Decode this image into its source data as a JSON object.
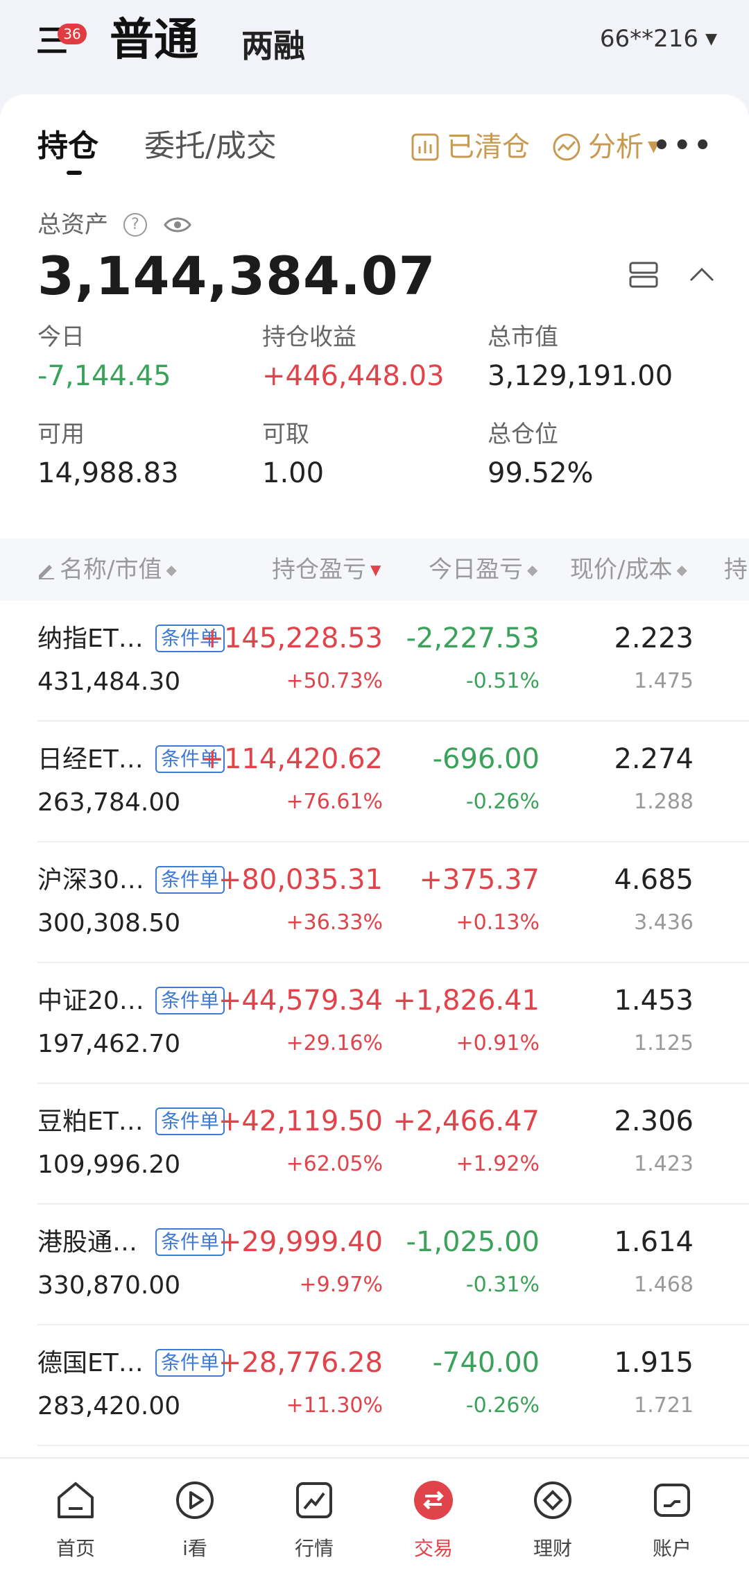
{
  "header": {
    "menu_badge": "36",
    "mode_primary": "普通",
    "mode_secondary": "两融",
    "account": "66**216"
  },
  "tabs": [
    {
      "label": "持仓",
      "active": true
    },
    {
      "label": "委托/成交",
      "active": false
    }
  ],
  "tools": {
    "cleared": "已清仓",
    "analysis": "分析"
  },
  "summary": {
    "total_label": "总资产",
    "total_value": "3,144,384.07",
    "stats": [
      {
        "label": "今日",
        "value": "-7,144.45",
        "tone": "green"
      },
      {
        "label": "持仓收益",
        "value": "+446,448.03",
        "tone": "red"
      },
      {
        "label": "总市值",
        "value": "3,129,191.00",
        "tone": "normal"
      },
      {
        "label": "可用",
        "value": "14,988.83",
        "tone": "normal"
      },
      {
        "label": "可取",
        "value": "1.00",
        "tone": "normal"
      },
      {
        "label": "总仓位",
        "value": "99.52%",
        "tone": "normal"
      }
    ]
  },
  "table": {
    "headers": {
      "name": "名称/市值",
      "holding_pl": "持仓盈亏",
      "today_pl": "今日盈亏",
      "price_cost": "现价/成本",
      "extra": "持"
    },
    "tag_label": "条件单",
    "rows": [
      {
        "name": "纳指ET…",
        "market_value": "431,484.30",
        "hold_pl": "+145,228.53",
        "hold_pct": "+50.73%",
        "today_pl": "-2,227.53",
        "today_pct": "-0.51%",
        "price": "2.223",
        "cost": "1.475",
        "hold_tone": "red",
        "today_tone": "green"
      },
      {
        "name": "日经ET…",
        "market_value": "263,784.00",
        "hold_pl": "+114,420.62",
        "hold_pct": "+76.61%",
        "today_pl": "-696.00",
        "today_pct": "-0.26%",
        "price": "2.274",
        "cost": "1.288",
        "hold_tone": "red",
        "today_tone": "green"
      },
      {
        "name": "沪深30…",
        "market_value": "300,308.50",
        "hold_pl": "+80,035.31",
        "hold_pct": "+36.33%",
        "today_pl": "+375.37",
        "today_pct": "+0.13%",
        "price": "4.685",
        "cost": "3.436",
        "hold_tone": "red",
        "today_tone": "red"
      },
      {
        "name": "中证20…",
        "market_value": "197,462.70",
        "hold_pl": "+44,579.34",
        "hold_pct": "+29.16%",
        "today_pl": "+1,826.41",
        "today_pct": "+0.91%",
        "price": "1.453",
        "cost": "1.125",
        "hold_tone": "red",
        "today_tone": "red"
      },
      {
        "name": "豆粕ET…",
        "market_value": "109,996.20",
        "hold_pl": "+42,119.50",
        "hold_pct": "+62.05%",
        "today_pl": "+2,466.47",
        "today_pct": "+1.92%",
        "price": "2.306",
        "cost": "1.423",
        "hold_tone": "red",
        "today_tone": "red"
      },
      {
        "name": "港股通…",
        "market_value": "330,870.00",
        "hold_pl": "+29,999.40",
        "hold_pct": "+9.97%",
        "today_pl": "-1,025.00",
        "today_pct": "-0.31%",
        "price": "1.614",
        "cost": "1.468",
        "hold_tone": "red",
        "today_tone": "green"
      },
      {
        "name": "德国ET…",
        "market_value": "283,420.00",
        "hold_pl": "+28,776.28",
        "hold_pct": "+11.30%",
        "today_pl": "-740.00",
        "today_pct": "-0.26%",
        "price": "1.915",
        "cost": "1.721",
        "hold_tone": "red",
        "today_tone": "green"
      }
    ]
  },
  "nav": [
    {
      "label": "首页",
      "icon": "home-icon",
      "active": false
    },
    {
      "label": "i看",
      "icon": "play-icon",
      "active": false
    },
    {
      "label": "行情",
      "icon": "market-chart-icon",
      "active": false
    },
    {
      "label": "交易",
      "icon": "trade-exchange-icon",
      "active": true
    },
    {
      "label": "理财",
      "icon": "wealth-diamond-icon",
      "active": false
    },
    {
      "label": "账户",
      "icon": "account-icon",
      "active": false
    }
  ],
  "colors": {
    "up_red": "#e0434a",
    "down_green": "#3aa25a",
    "tag_blue": "#3f7bd6",
    "tool_gold": "#c79a4f"
  }
}
